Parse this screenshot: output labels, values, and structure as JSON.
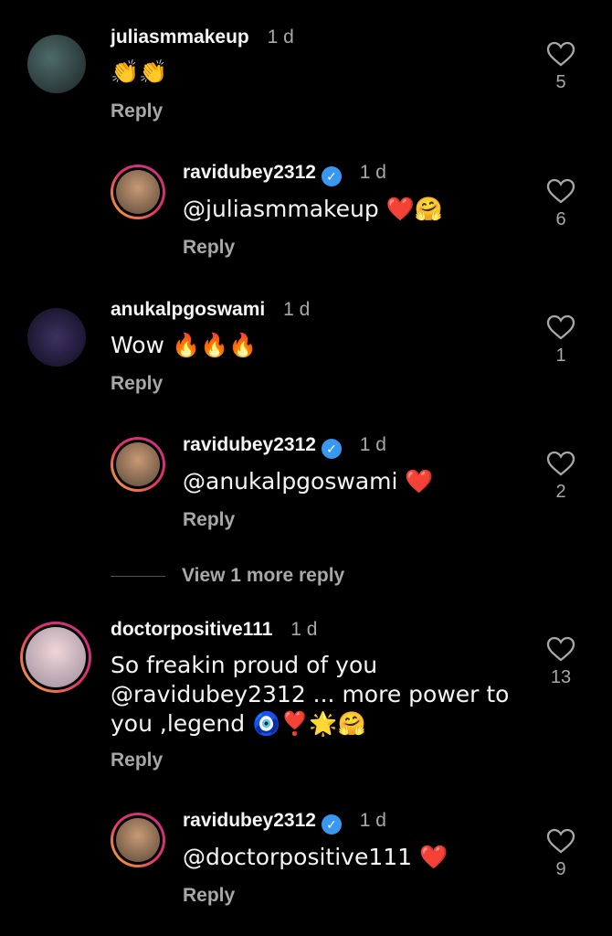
{
  "comments": [
    {
      "username": "juliasmmakeup",
      "time": "1 d",
      "text": "👏👏",
      "reply": "Reply",
      "likes": "5"
    },
    {
      "username": "ravidubey2312",
      "time": "1 d",
      "text": "@juliasmmakeup ❤️🤗",
      "reply": "Reply",
      "likes": "6"
    },
    {
      "username": "anukalpgoswami",
      "time": "1 d",
      "text": "Wow 🔥🔥🔥",
      "reply": "Reply",
      "likes": "1"
    },
    {
      "username": "ravidubey2312",
      "time": "1 d",
      "text": "@anukalpgoswami ❤️",
      "reply": "Reply",
      "likes": "2"
    },
    {
      "username": "doctorpositive111",
      "time": "1 d",
      "text_lines": [
        "So freakin proud of you",
        "@ravidubey2312 ... more power to",
        "you ,legend 🧿❣️🌟🤗"
      ],
      "reply": "Reply",
      "likes": "13"
    },
    {
      "username": "ravidubey2312",
      "time": "1 d",
      "text": "@doctorpositive111 ❤️",
      "reply": "Reply",
      "likes": "9"
    }
  ],
  "view_more": "View 1 more reply",
  "colors": {
    "background": "#000000",
    "secondary_text": "#a8a8a8",
    "verified": "#3897f0"
  }
}
